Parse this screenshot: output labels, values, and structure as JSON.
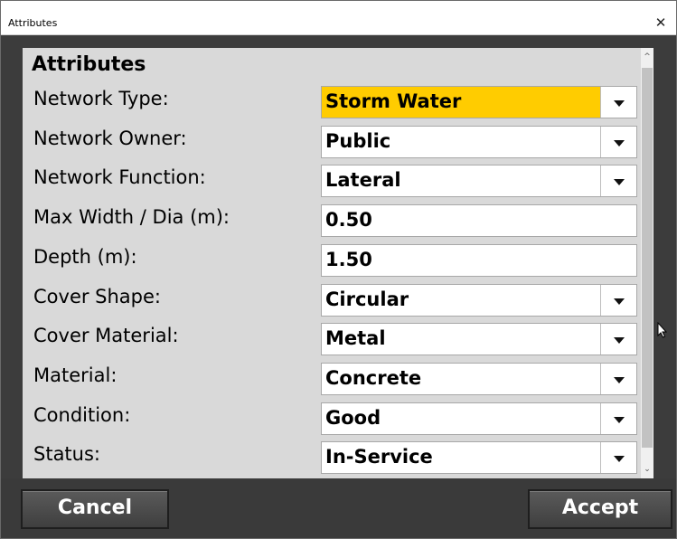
{
  "window": {
    "title": "Attributes",
    "close_glyph": "✕"
  },
  "section": {
    "title": "Attributes"
  },
  "rows": [
    {
      "label": "Network Type:",
      "value": "Storm Water",
      "type": "combo",
      "highlight": true
    },
    {
      "label": "Network Owner:",
      "value": "Public",
      "type": "combo"
    },
    {
      "label": "Network Function:",
      "value": "Lateral",
      "type": "combo"
    },
    {
      "label": "Max Width / Dia (m):",
      "value": "0.50",
      "type": "text"
    },
    {
      "label": "Depth (m):",
      "value": "1.50",
      "type": "text"
    },
    {
      "label": "Cover Shape:",
      "value": "Circular",
      "type": "combo"
    },
    {
      "label": "Cover Material:",
      "value": "Metal",
      "type": "combo"
    },
    {
      "label": "Material:",
      "value": "Concrete",
      "type": "combo"
    },
    {
      "label": "Condition:",
      "value": "Good",
      "type": "combo"
    },
    {
      "label": "Status:",
      "value": "In-Service",
      "type": "combo"
    }
  ],
  "scroll": {
    "up_glyph": "^",
    "down_glyph": "⌄"
  },
  "buttons": {
    "cancel": "Cancel",
    "accept": "Accept"
  },
  "colors": {
    "highlight": "#ffcc00",
    "panel": "#d9d9d9",
    "bottom_bar": "#3a3a3a"
  },
  "icons": {
    "dropdown": "chevron-down-icon",
    "close": "close-icon",
    "cursor": "mouse-pointer-icon"
  }
}
